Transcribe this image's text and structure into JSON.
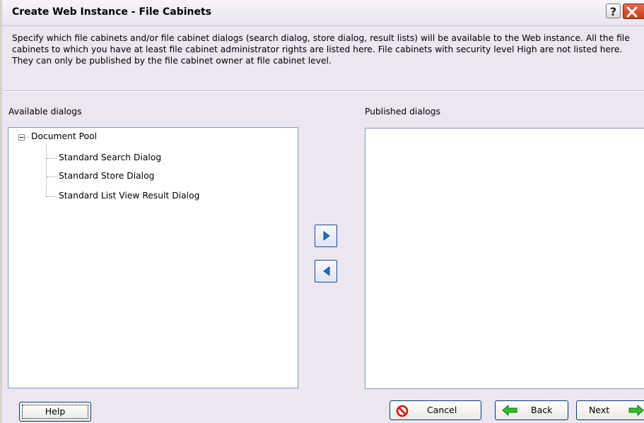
{
  "window": {
    "title": "Create Web Instance - File Cabinets",
    "description": "Specify which file cabinets and/or file cabinet dialogs (search dialog, store dialog, result lists) will be available to the Web instance. All the file cabinets to which you have at least file cabinet administrator rights are listed here. File cabinets with security level High are not listed here. They can only be published by the file cabinet owner at file cabinet level."
  },
  "titlebar_buttons": {
    "help": "?"
  },
  "available": {
    "label": "Available dialogs",
    "tree": {
      "root": "Document Pool",
      "children": [
        "Standard Search Dialog",
        "Standard Store Dialog",
        "Standard List View Result Dialog"
      ]
    }
  },
  "published": {
    "label": "Published dialogs",
    "items": []
  },
  "buttons": {
    "help": "Help",
    "cancel": "Cancel",
    "back": "Back",
    "next": "Next"
  }
}
